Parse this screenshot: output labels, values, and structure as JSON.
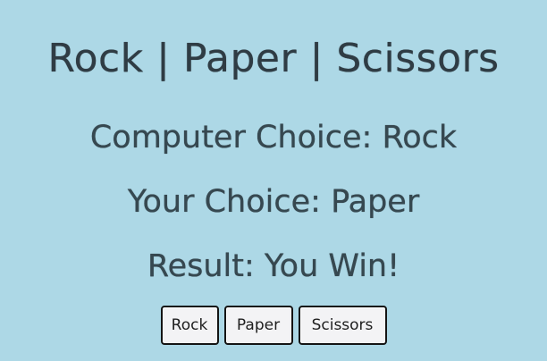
{
  "title": "Rock | Paper | Scissors",
  "computer_choice": {
    "label": "Computer Choice:",
    "value": "Rock"
  },
  "player_choice": {
    "label": "Your Choice:",
    "value": "Paper"
  },
  "result": {
    "label": "Result:",
    "value": "You Win!"
  },
  "buttons": {
    "rock": "Rock",
    "paper": "Paper",
    "scissors": "Scissors"
  },
  "colors": {
    "background": "#add8e6",
    "text": "#364850",
    "button_background": "#f3f3f5",
    "button_border": "#141414"
  }
}
